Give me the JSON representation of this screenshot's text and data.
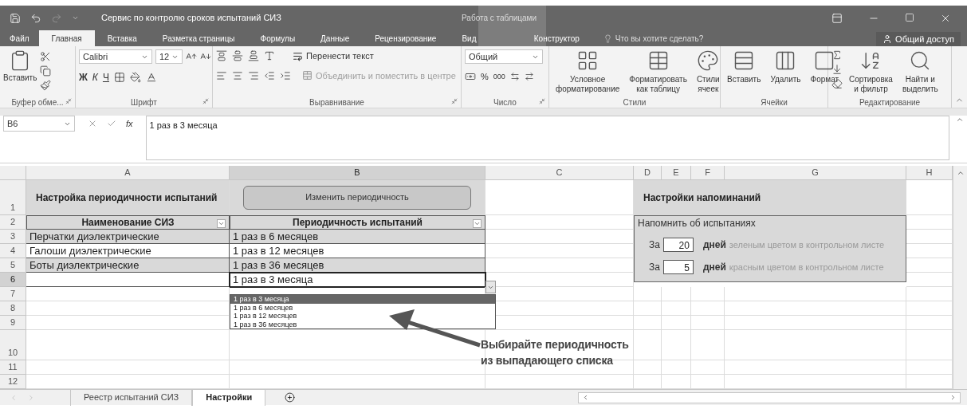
{
  "window": {
    "title": "Сервис по контролю сроков испытаний СИЗ",
    "context_group": "Работа с таблицами"
  },
  "ribbon_tabs": [
    {
      "label": "Файл",
      "selected": false,
      "kind": "file"
    },
    {
      "label": "Главная",
      "selected": true,
      "kind": "normal"
    },
    {
      "label": "Вставка",
      "selected": false,
      "kind": "normal"
    },
    {
      "label": "Разметка страницы",
      "selected": false,
      "kind": "normal"
    },
    {
      "label": "Формулы",
      "selected": false,
      "kind": "normal"
    },
    {
      "label": "Данные",
      "selected": false,
      "kind": "normal"
    },
    {
      "label": "Рецензирование",
      "selected": false,
      "kind": "normal"
    },
    {
      "label": "Вид",
      "selected": false,
      "kind": "normal"
    },
    {
      "label": "Конструктор",
      "selected": false,
      "kind": "context"
    }
  ],
  "tell_me": {
    "placeholder": "Что вы хотите сделать?"
  },
  "share_button": "Общий доступ",
  "ribbon": {
    "clipboard": {
      "label": "Буфер обме...",
      "paste": "Вставить"
    },
    "font": {
      "label": "Шрифт",
      "font_name": "Calibri",
      "font_size": "12",
      "bold": "Ж",
      "italic": "К",
      "underline": "Ч"
    },
    "alignment": {
      "label": "Выравнивание",
      "wrap": "Перенести текст",
      "merge": {
        "label": "Объединить и поместить в центре",
        "disabled": true
      }
    },
    "number": {
      "label": "Число",
      "format": "Общий",
      "percent": "%",
      "thousands": "000"
    },
    "styles": {
      "label": "Стили",
      "buttons": [
        "Условное\nформатирование",
        "Форматировать\nкак таблицу",
        "Стили\nячеек"
      ]
    },
    "cells": {
      "label": "Ячейки",
      "buttons": [
        "Вставить",
        "Удалить",
        "Формат"
      ]
    },
    "editing": {
      "label": "Редактирование",
      "buttons": [
        "Сортировка\nи фильтр",
        "Найти и\nвыделить"
      ]
    }
  },
  "formula_bar": {
    "name_box": "B6",
    "function_label": "fx",
    "formula": "1 раз в 3 месяца"
  },
  "columns": [
    {
      "label": "A",
      "selected": false
    },
    {
      "label": "B",
      "selected": true
    },
    {
      "label": "C",
      "selected": false
    },
    {
      "label": "D",
      "selected": false
    },
    {
      "label": "E",
      "selected": false
    },
    {
      "label": "F",
      "selected": false
    },
    {
      "label": "G",
      "selected": false
    },
    {
      "label": "H",
      "selected": false
    }
  ],
  "rows": [
    {
      "label": "1",
      "selected": false
    },
    {
      "label": "2",
      "selected": false
    },
    {
      "label": "3",
      "selected": false
    },
    {
      "label": "4",
      "selected": false
    },
    {
      "label": "5",
      "selected": false
    },
    {
      "label": "6",
      "selected": true
    },
    {
      "label": "7",
      "selected": false
    },
    {
      "label": "8",
      "selected": false
    },
    {
      "label": "9",
      "selected": false
    },
    {
      "label": "10",
      "selected": false
    },
    {
      "label": "11",
      "selected": false
    },
    {
      "label": "12",
      "selected": false
    }
  ],
  "settings_table": {
    "title": "Настройка периодичности испытаний",
    "button": "Изменить периодичность",
    "headers": [
      "Наименование СИЗ",
      "Периодичность испытаний"
    ],
    "rows": [
      {
        "name": "Перчатки диэлектрические",
        "period": "1 раз в 6 месяцев",
        "active": false
      },
      {
        "name": "Галоши диэлектрические",
        "period": "1 раз в 12 месяцев",
        "active": false
      },
      {
        "name": "Боты диэлектрические",
        "period": "1 раз в 36 месяцев",
        "active": false
      },
      {
        "period": "1 раз в 3 месяца",
        "active": true
      }
    ]
  },
  "dropdown": {
    "options": [
      {
        "label": "1 раз в 3 месяца",
        "selected": true
      },
      {
        "label": "1 раз в 6 месяцев",
        "selected": false
      },
      {
        "label": "1 раз в 12 месяцев",
        "selected": false
      },
      {
        "label": "1 раз в 36 месяцев",
        "selected": false
      }
    ]
  },
  "reminders": {
    "title": "Настройки напоминаний",
    "caption": "Напомнить об испытаниях",
    "items": [
      {
        "prefix": "За",
        "days": "20",
        "unit": "дней",
        "note": "зеленым цветом в контрольном листе"
      },
      {
        "prefix": "За",
        "days": "5",
        "unit": "дней",
        "note": "красным цветом в контрольном листе"
      }
    ]
  },
  "annotation": "Выбирайте периодичность\nиз выпадающего списка",
  "sheet_tabs": [
    {
      "label": "Реестр испытаний СИЗ",
      "selected": false
    },
    {
      "label": "Настройки",
      "selected": true
    }
  ]
}
